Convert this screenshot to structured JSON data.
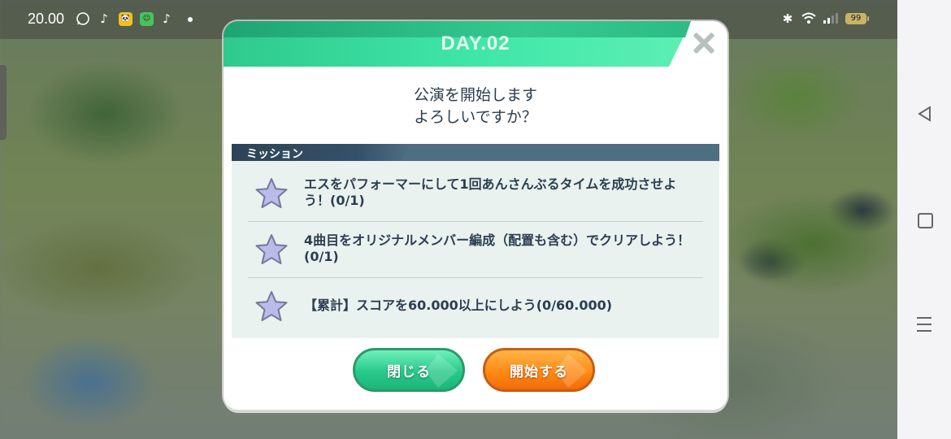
{
  "status_bar": {
    "time": "20.00",
    "battery": "99"
  },
  "dialog": {
    "title": "DAY.02",
    "prompt_line1": "公演を開始します",
    "prompt_line2": "よろしいですか？",
    "mission_header": "ミッション",
    "missions": [
      {
        "text": "エスをパフォーマーにして1回あんさんぶるタイムを成功させよう！(0/1)"
      },
      {
        "text": "4曲目をオリジナルメンバー編成（配置も含む）でクリアしよう！(0/1)"
      },
      {
        "text": "【累計】スコアを60.000以上にしよう(0/60.000)"
      }
    ],
    "close_label": "閉じる",
    "start_label": "開始する"
  },
  "colors": {
    "header_green": "#3fe6a8",
    "close_button": "#28c98a",
    "start_button": "#ff8a14",
    "mission_bar": "#4e6e82",
    "star": "#b9bbe8"
  }
}
